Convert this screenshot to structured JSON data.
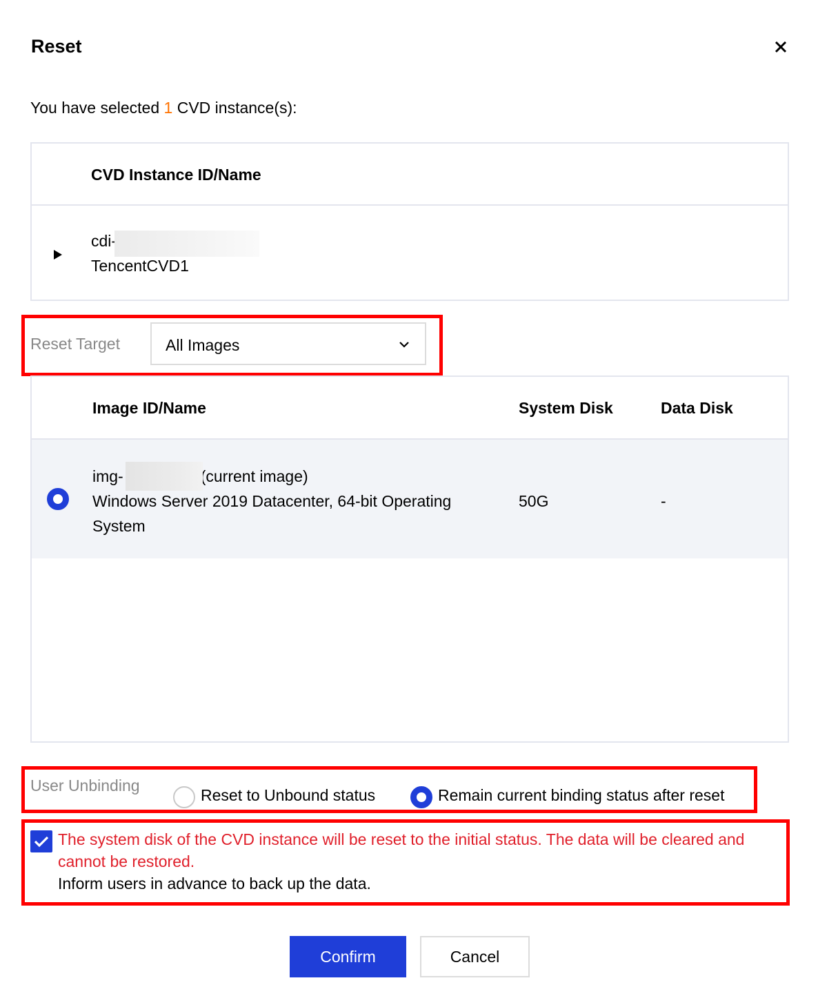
{
  "dialog": {
    "title": "Reset"
  },
  "selection": {
    "prefix": "You have selected ",
    "count": "1",
    "suffix": " CVD instance(s):"
  },
  "instance_table": {
    "header": "CVD Instance ID/Name",
    "rows": [
      {
        "id": "cdi-",
        "name": "TencentCVD1"
      }
    ]
  },
  "reset_target": {
    "label": "Reset Target",
    "selected": "All Images"
  },
  "image_table": {
    "headers": [
      "Image ID/Name",
      "System Disk",
      "Data Disk"
    ],
    "rows": [
      {
        "id_prefix": "img-",
        "id_suffix": "(current image)",
        "name_line1": "Windows Server 2019 Datacenter, 64-bit Operating",
        "name_line2": "System",
        "system_disk": "50G",
        "data_disk": "-",
        "selected": true
      }
    ]
  },
  "user_unbinding": {
    "label": "User Unbinding",
    "options": [
      {
        "label": "Reset to Unbound status",
        "selected": false
      },
      {
        "label": "Remain current binding status after reset",
        "selected": true
      }
    ]
  },
  "warning": {
    "checked": true,
    "line1": "The system disk of the CVD instance will be reset to the initial status. The data will be cleared and",
    "line2": "cannot be restored.",
    "line3": "Inform users in advance to back up the data."
  },
  "buttons": {
    "confirm": "Confirm",
    "cancel": "Cancel"
  },
  "colors": {
    "primary": "#1f3ed8",
    "highlight_box": "#ff0000",
    "warning_text": "#e0202b",
    "count_accent": "#ff7200",
    "selected_row_bg": "#f2f4f8"
  },
  "icons": {
    "close": "close-icon",
    "expand": "triangle-right-icon",
    "dropdown": "chevron-down-icon",
    "checkbox": "checkmark-icon"
  }
}
